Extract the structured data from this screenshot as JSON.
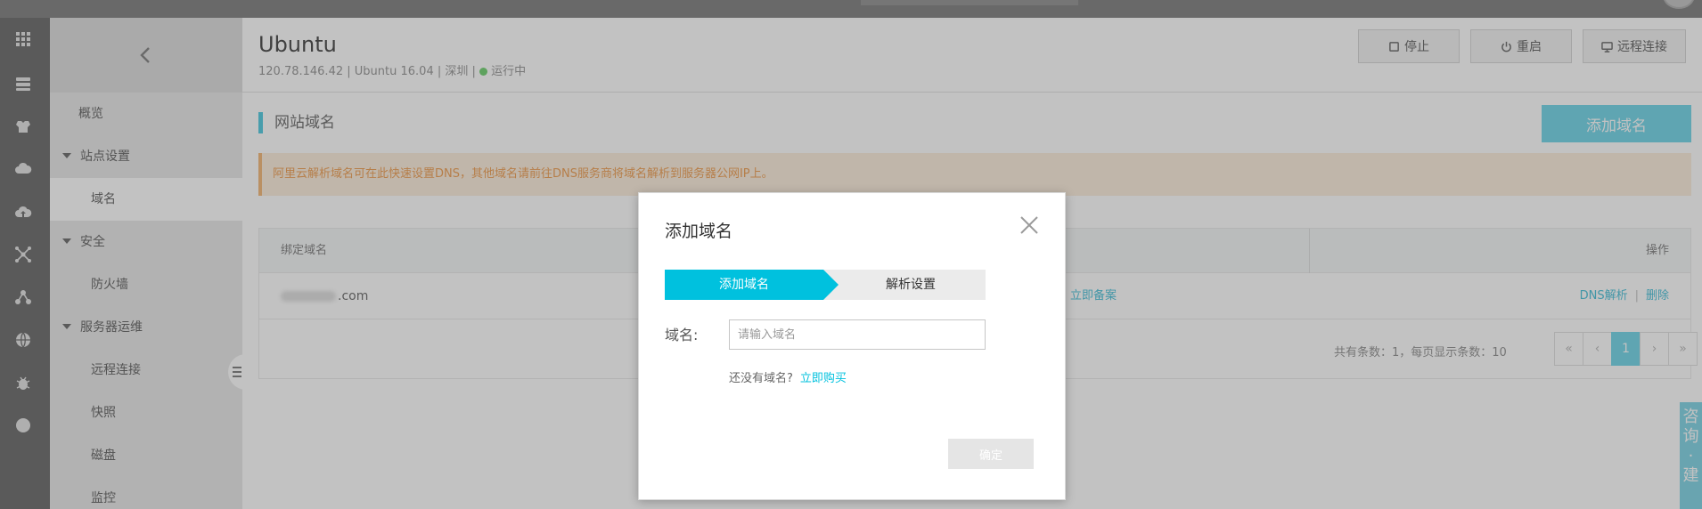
{
  "sidebar": {
    "items": [
      {
        "label": "概览"
      },
      {
        "label": "站点设置"
      },
      {
        "label": "域名"
      },
      {
        "label": "安全"
      },
      {
        "label": "防火墙"
      },
      {
        "label": "服务器运维"
      },
      {
        "label": "远程连接"
      },
      {
        "label": "快照"
      },
      {
        "label": "磁盘"
      },
      {
        "label": "监控"
      }
    ]
  },
  "header": {
    "title": "Ubuntu",
    "ip": "120.78.146.42",
    "os": "Ubuntu 16.04",
    "region": "深圳",
    "separator": "|",
    "status": "运行中",
    "buttons": {
      "stop": "停止",
      "restart": "重启",
      "remote": "远程连接"
    }
  },
  "section": {
    "title": "网站域名",
    "add_button": "添加域名"
  },
  "notice": "阿里云解析域名可在此快速设置DNS，其他域名请前往DNS服务商将域名解析到服务器公网IP上。",
  "table": {
    "columns": {
      "domain": "绑定域名",
      "action": "操作"
    },
    "rows": [
      {
        "domain_suffix": ".com",
        "icp_link": "立即备案",
        "dns_action": "DNS解析",
        "delete_action": "删除",
        "separator": "|"
      }
    ]
  },
  "pagination": {
    "info": "共有条数：1，每页显示条数：10",
    "first": "«",
    "prev": "‹",
    "current": "1",
    "next": "›",
    "last": "»"
  },
  "consult": {
    "label": "咨\n询\n·\n建"
  },
  "dialog": {
    "title": "添加域名",
    "steps": [
      "添加域名",
      "解析设置"
    ],
    "field_label": "域名:",
    "placeholder": "请输入域名",
    "hint": "还没有域名?",
    "buy_link": "立即购买",
    "confirm": "确定"
  },
  "colors": {
    "accent": "#00c1de",
    "accent_light": "#7ed9ea",
    "notice_bg": "#fdf0e0",
    "notice_text": "#f0a660",
    "status_green": "#7cd57c"
  }
}
